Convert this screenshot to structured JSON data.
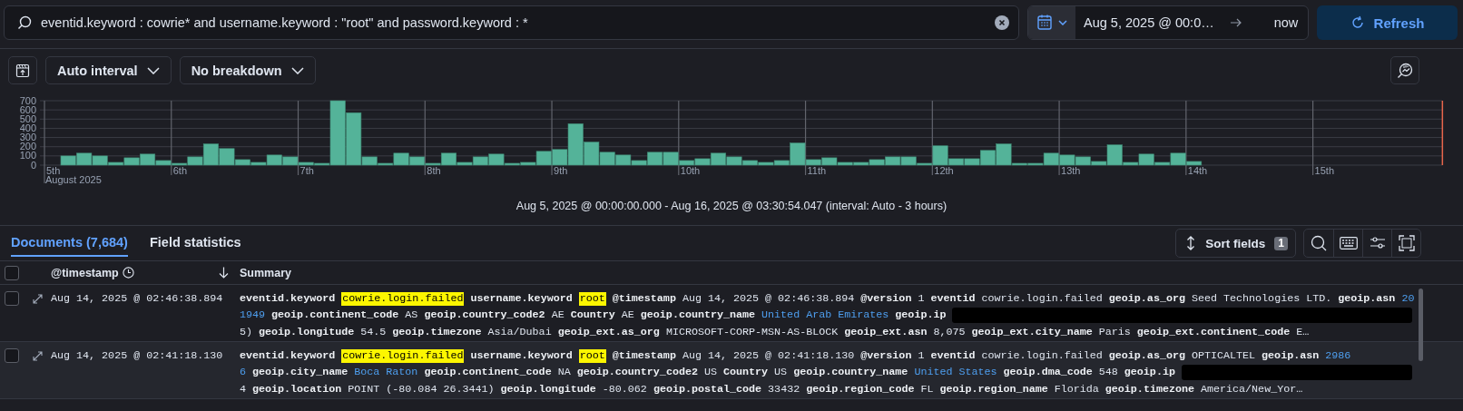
{
  "query_bar": {
    "query": "eventid.keyword : cowrie* and username.keyword : \"root\" and password.keyword : *",
    "date_start": "Aug 5, 2025 @ 00:0…",
    "date_end": "now",
    "refresh_label": "Refresh"
  },
  "chart_toolbar": {
    "interval": "Auto interval",
    "breakdown": "No breakdown"
  },
  "histogram": {
    "chart_data": {
      "type": "bar",
      "xlabel": "August 2025",
      "categories": [
        "5th",
        null,
        null,
        null,
        null,
        null,
        null,
        null,
        "6th",
        null,
        null,
        null,
        null,
        null,
        null,
        null,
        "7th",
        null,
        null,
        null,
        null,
        null,
        null,
        null,
        "8th",
        null,
        null,
        null,
        null,
        null,
        null,
        null,
        "9th",
        null,
        null,
        null,
        null,
        null,
        null,
        null,
        "10th",
        null,
        null,
        null,
        null,
        null,
        null,
        null,
        "11th",
        null,
        null,
        null,
        null,
        null,
        null,
        null,
        "12th",
        null,
        null,
        null,
        null,
        null,
        null,
        null,
        "13th",
        null,
        null,
        null,
        null,
        null,
        null,
        null,
        "14th",
        null,
        null,
        null,
        null,
        null,
        null,
        null,
        "15th",
        null,
        null,
        null,
        null,
        null,
        null,
        null,
        null
      ],
      "values": [
        0,
        100,
        130,
        100,
        30,
        80,
        120,
        50,
        20,
        90,
        230,
        180,
        60,
        30,
        110,
        90,
        30,
        20,
        700,
        570,
        90,
        20,
        130,
        90,
        20,
        130,
        30,
        90,
        120,
        20,
        30,
        150,
        170,
        450,
        250,
        140,
        110,
        50,
        140,
        140,
        50,
        70,
        130,
        90,
        50,
        30,
        50,
        240,
        60,
        80,
        30,
        30,
        60,
        90,
        90,
        20,
        210,
        70,
        70,
        160,
        230,
        20,
        20,
        130,
        110,
        90,
        40,
        220,
        30,
        120,
        30,
        130,
        40,
        0,
        0,
        0,
        0,
        0,
        0,
        0,
        0,
        0,
        0,
        0,
        0,
        0,
        0,
        0,
        0
      ],
      "ylim": [
        0,
        700
      ],
      "yticks": [
        0,
        100,
        200,
        300,
        400,
        500,
        600,
        700
      ],
      "grid": true
    },
    "time_range": "Aug 5, 2025 @ 00:00:00.000 - Aug 16, 2025 @ 03:30:54.047 (interval: Auto - 3 hours)"
  },
  "tabs": [
    {
      "label": "Documents (7,684)",
      "selected": true
    },
    {
      "label": "Field statistics",
      "selected": false
    }
  ],
  "sort_fields": {
    "label": "Sort fields",
    "count": "1"
  },
  "table": {
    "header_checked": false,
    "columns": [
      "@timestamp",
      "Summary"
    ],
    "rows": [
      {
        "checked": false,
        "timestamp": "Aug 14, 2025 @ 02:46:38.894",
        "summary_lines": [
          [
            {
              "kind": "field",
              "text": "eventid.keyword"
            },
            {
              "kind": "highlight",
              "text": "cowrie.login.failed"
            },
            {
              "kind": "field",
              "text": "username.keyword"
            },
            {
              "kind": "highlight",
              "text": "root"
            },
            {
              "kind": "field",
              "text": "@timestamp"
            },
            {
              "kind": "value",
              "text": "Aug 14, 2025 @ 02:46:38.894"
            },
            {
              "kind": "field",
              "text": "@version"
            },
            {
              "kind": "value",
              "text": "1"
            },
            {
              "kind": "field",
              "text": "eventid"
            },
            {
              "kind": "value",
              "text": "cowrie.login.failed"
            },
            {
              "kind": "field",
              "text": "geoip.as_org"
            },
            {
              "kind": "value",
              "text": "Seed Technologies LTD."
            },
            {
              "kind": "field",
              "text": "geoip.asn"
            },
            {
              "kind": "link",
              "text": "20"
            }
          ],
          [
            {
              "kind": "link",
              "text": "1949"
            },
            {
              "kind": "field",
              "text": "geoip.continent_code"
            },
            {
              "kind": "value",
              "text": "AS"
            },
            {
              "kind": "field",
              "text": "geoip.country_code2"
            },
            {
              "kind": "value",
              "text": "AE"
            },
            {
              "kind": "field",
              "text": "Country"
            },
            {
              "kind": "value",
              "text": "AE"
            },
            {
              "kind": "field",
              "text": "geoip.country_name"
            },
            {
              "kind": "link",
              "text": "United Arab Emirates"
            },
            {
              "kind": "field",
              "text": "geoip.ip"
            },
            {
              "kind": "redacted"
            }
          ],
          [
            {
              "kind": "value",
              "text": "5)"
            },
            {
              "kind": "field",
              "text": "geoip.longitude"
            },
            {
              "kind": "value",
              "text": "54.5"
            },
            {
              "kind": "field",
              "text": "geoip.timezone"
            },
            {
              "kind": "value",
              "text": "Asia/Dubai"
            },
            {
              "kind": "field",
              "text": "geoip_ext.as_org"
            },
            {
              "kind": "value",
              "text": "MICROSOFT-CORP-MSN-AS-BLOCK"
            },
            {
              "kind": "field",
              "text": "geoip_ext.asn"
            },
            {
              "kind": "value",
              "text": "8,075"
            },
            {
              "kind": "field",
              "text": "geoip_ext.city_name"
            },
            {
              "kind": "value",
              "text": "Paris"
            },
            {
              "kind": "field",
              "text": "geoip_ext.continent_code"
            },
            {
              "kind": "value",
              "text": "E…"
            }
          ]
        ]
      },
      {
        "checked": false,
        "timestamp": "Aug 14, 2025 @ 02:41:18.130",
        "summary_lines": [
          [
            {
              "kind": "field",
              "text": "eventid.keyword"
            },
            {
              "kind": "highlight",
              "text": "cowrie.login.failed"
            },
            {
              "kind": "field",
              "text": "username.keyword"
            },
            {
              "kind": "highlight",
              "text": "root"
            },
            {
              "kind": "field",
              "text": "@timestamp"
            },
            {
              "kind": "value",
              "text": "Aug 14, 2025 @ 02:41:18.130"
            },
            {
              "kind": "field",
              "text": "@version"
            },
            {
              "kind": "value",
              "text": "1"
            },
            {
              "kind": "field",
              "text": "eventid"
            },
            {
              "kind": "value",
              "text": "cowrie.login.failed"
            },
            {
              "kind": "field",
              "text": "geoip.as_org"
            },
            {
              "kind": "value",
              "text": "OPTICALTEL"
            },
            {
              "kind": "field",
              "text": "geoip.asn"
            },
            {
              "kind": "link",
              "text": "2986"
            }
          ],
          [
            {
              "kind": "link",
              "text": "6"
            },
            {
              "kind": "field",
              "text": "geoip.city_name"
            },
            {
              "kind": "link",
              "text": "Boca Raton"
            },
            {
              "kind": "field",
              "text": "geoip.continent_code"
            },
            {
              "kind": "value",
              "text": "NA"
            },
            {
              "kind": "field",
              "text": "geoip.country_code2"
            },
            {
              "kind": "value",
              "text": "US"
            },
            {
              "kind": "field",
              "text": "Country"
            },
            {
              "kind": "value",
              "text": "US"
            },
            {
              "kind": "field",
              "text": "geoip.country_name"
            },
            {
              "kind": "link",
              "text": "United States"
            },
            {
              "kind": "field",
              "text": "geoip.dma_code"
            },
            {
              "kind": "value",
              "text": "548"
            },
            {
              "kind": "field",
              "text": "geoip.ip"
            },
            {
              "kind": "redacted"
            }
          ],
          [
            {
              "kind": "value",
              "text": "4"
            },
            {
              "kind": "field",
              "text": "geoip.location"
            },
            {
              "kind": "value",
              "text": "POINT (-80.084 26.3441)"
            },
            {
              "kind": "field",
              "text": "geoip.longitude"
            },
            {
              "kind": "value",
              "text": "-80.062"
            },
            {
              "kind": "field",
              "text": "geoip.postal_code"
            },
            {
              "kind": "value",
              "text": "33432"
            },
            {
              "kind": "field",
              "text": "geoip.region_code"
            },
            {
              "kind": "value",
              "text": "FL"
            },
            {
              "kind": "field",
              "text": "geoip.region_name"
            },
            {
              "kind": "value",
              "text": "Florida"
            },
            {
              "kind": "field",
              "text": "geoip.timezone"
            },
            {
              "kind": "value",
              "text": "America/New_Yor…"
            }
          ]
        ]
      }
    ]
  }
}
